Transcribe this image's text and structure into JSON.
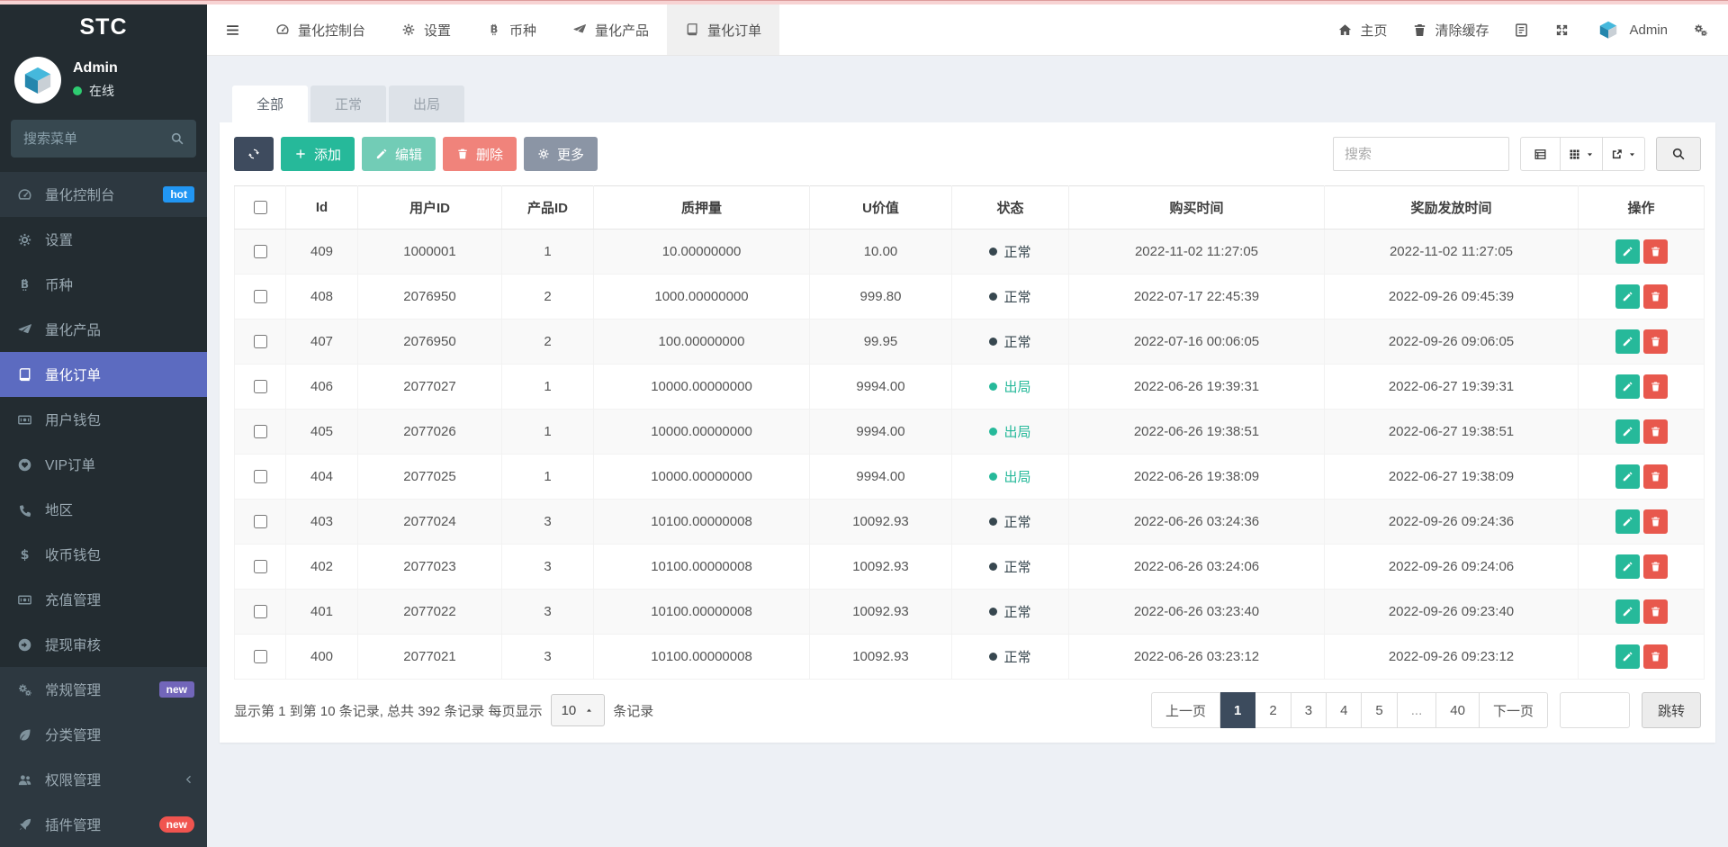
{
  "app": {
    "brand": "STC"
  },
  "sidebar": {
    "user": {
      "name": "Admin",
      "status": "在线"
    },
    "search_placeholder": "搜索菜单",
    "items": [
      {
        "key": "quant-console",
        "label": "量化控制台",
        "icon": "gauge-icon",
        "badge": "hot",
        "badge_color": "#2196f3",
        "alt": true
      },
      {
        "key": "settings",
        "label": "设置",
        "icon": "gear-icon"
      },
      {
        "key": "coins",
        "label": "币种",
        "icon": "bitcoin-icon"
      },
      {
        "key": "quant-products",
        "label": "量化产品",
        "icon": "send-icon"
      },
      {
        "key": "quant-orders",
        "label": "量化订单",
        "icon": "book-icon",
        "active": true
      },
      {
        "key": "user-wallet",
        "label": "用户钱包",
        "icon": "money-icon"
      },
      {
        "key": "vip-orders",
        "label": "VIP订单",
        "icon": "heart-circle-icon"
      },
      {
        "key": "regions",
        "label": "地区",
        "icon": "phone-icon"
      },
      {
        "key": "receive-wallet",
        "label": "收币钱包",
        "icon": "dollar-icon"
      },
      {
        "key": "recharge",
        "label": "充值管理",
        "icon": "money-icon"
      },
      {
        "key": "withdraw-review",
        "label": "提现审核",
        "icon": "arrow-circle-icon"
      },
      {
        "key": "general",
        "label": "常规管理",
        "icon": "gears-icon",
        "badge": "new",
        "badge_color": "#7266ba",
        "alt": true
      },
      {
        "key": "category",
        "label": "分类管理",
        "icon": "leaf-icon",
        "alt": true
      },
      {
        "key": "permissions",
        "label": "权限管理",
        "icon": "users-icon",
        "chevron": true,
        "alt": true
      },
      {
        "key": "plugins",
        "label": "插件管理",
        "icon": "rocket-icon",
        "badge": "new",
        "badge_color": "#f0544f",
        "badge_pill": true,
        "alt": true
      }
    ]
  },
  "topnav": {
    "tabs": [
      {
        "key": "quant-console",
        "label": "量化控制台",
        "icon": "gauge-icon"
      },
      {
        "key": "settings",
        "label": "设置",
        "icon": "gear-icon"
      },
      {
        "key": "coins",
        "label": "币种",
        "icon": "bitcoin-icon"
      },
      {
        "key": "quant-products",
        "label": "量化产品",
        "icon": "send-icon"
      },
      {
        "key": "quant-orders",
        "label": "量化订单",
        "icon": "book-icon",
        "active": true
      }
    ],
    "right": [
      {
        "name": "home",
        "label": "主页",
        "icon": "home-icon"
      },
      {
        "name": "clear-cache",
        "label": "清除缓存",
        "icon": "trash-icon"
      },
      {
        "name": "language",
        "icon": "language-icon"
      },
      {
        "name": "fullscreen",
        "icon": "expand-icon"
      },
      {
        "name": "user",
        "label": "Admin",
        "icon": "cube-logo"
      },
      {
        "name": "settings",
        "icon": "gears-icon"
      }
    ]
  },
  "filter_tabs": {
    "items": [
      "全部",
      "正常",
      "出局"
    ],
    "active_index": 0
  },
  "toolbar": {
    "add_label": "添加",
    "edit_label": "编辑",
    "delete_label": "删除",
    "more_label": "更多",
    "search_placeholder": "搜索"
  },
  "table": {
    "columns": [
      "Id",
      "用户ID",
      "产品ID",
      "质押量",
      "U价值",
      "状态",
      "购买时间",
      "奖励发放时间",
      "操作"
    ],
    "status_colors": {
      "normal": "#37474f",
      "out": "#26b99a"
    },
    "rows": [
      {
        "id": "409",
        "user_id": "1000001",
        "product_id": "1",
        "amount": "10.00000000",
        "u_value": "10.00",
        "status": "正常",
        "status_type": "normal",
        "buy_time": "2022-11-02 11:27:05",
        "reward_time": "2022-11-02 11:27:05"
      },
      {
        "id": "408",
        "user_id": "2076950",
        "product_id": "2",
        "amount": "1000.00000000",
        "u_value": "999.80",
        "status": "正常",
        "status_type": "normal",
        "buy_time": "2022-07-17 22:45:39",
        "reward_time": "2022-09-26 09:45:39"
      },
      {
        "id": "407",
        "user_id": "2076950",
        "product_id": "2",
        "amount": "100.00000000",
        "u_value": "99.95",
        "status": "正常",
        "status_type": "normal",
        "buy_time": "2022-07-16 00:06:05",
        "reward_time": "2022-09-26 09:06:05"
      },
      {
        "id": "406",
        "user_id": "2077027",
        "product_id": "1",
        "amount": "10000.00000000",
        "u_value": "9994.00",
        "status": "出局",
        "status_type": "out",
        "buy_time": "2022-06-26 19:39:31",
        "reward_time": "2022-06-27 19:39:31"
      },
      {
        "id": "405",
        "user_id": "2077026",
        "product_id": "1",
        "amount": "10000.00000000",
        "u_value": "9994.00",
        "status": "出局",
        "status_type": "out",
        "buy_time": "2022-06-26 19:38:51",
        "reward_time": "2022-06-27 19:38:51"
      },
      {
        "id": "404",
        "user_id": "2077025",
        "product_id": "1",
        "amount": "10000.00000000",
        "u_value": "9994.00",
        "status": "出局",
        "status_type": "out",
        "buy_time": "2022-06-26 19:38:09",
        "reward_time": "2022-06-27 19:38:09"
      },
      {
        "id": "403",
        "user_id": "2077024",
        "product_id": "3",
        "amount": "10100.00000008",
        "u_value": "10092.93",
        "status": "正常",
        "status_type": "normal",
        "buy_time": "2022-06-26 03:24:36",
        "reward_time": "2022-09-26 09:24:36"
      },
      {
        "id": "402",
        "user_id": "2077023",
        "product_id": "3",
        "amount": "10100.00000008",
        "u_value": "10092.93",
        "status": "正常",
        "status_type": "normal",
        "buy_time": "2022-06-26 03:24:06",
        "reward_time": "2022-09-26 09:24:06"
      },
      {
        "id": "401",
        "user_id": "2077022",
        "product_id": "3",
        "amount": "10100.00000008",
        "u_value": "10092.93",
        "status": "正常",
        "status_type": "normal",
        "buy_time": "2022-06-26 03:23:40",
        "reward_time": "2022-09-26 09:23:40"
      },
      {
        "id": "400",
        "user_id": "2077021",
        "product_id": "3",
        "amount": "10100.00000008",
        "u_value": "10092.93",
        "status": "正常",
        "status_type": "normal",
        "buy_time": "2022-06-26 03:23:12",
        "reward_time": "2022-09-26 09:23:12"
      }
    ]
  },
  "footer": {
    "summary_prefix": "显示第 1 到第 10 条记录, 总共 392 条记录 每页显示",
    "per_page": "10",
    "summary_suffix": "条记录",
    "jump_label": "跳转",
    "pagination": [
      {
        "label": "上一页"
      },
      {
        "label": "1",
        "active": true
      },
      {
        "label": "2"
      },
      {
        "label": "3"
      },
      {
        "label": "4"
      },
      {
        "label": "5"
      },
      {
        "label": "...",
        "disabled": true
      },
      {
        "label": "40"
      },
      {
        "label": "下一页"
      }
    ]
  }
}
